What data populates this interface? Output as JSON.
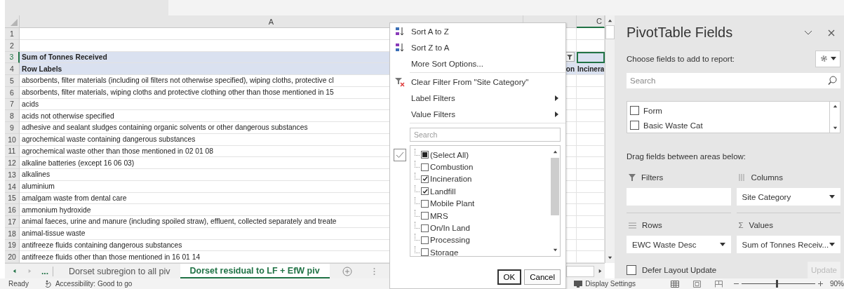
{
  "sheet": {
    "column_a": "A",
    "column_c": "C",
    "rows": [
      {
        "number": "1",
        "kind": "blank",
        "selected": false
      },
      {
        "number": "2",
        "kind": "blank",
        "selected": false
      },
      {
        "number": "3",
        "kind": "header",
        "label": "Sum of Tonnes Received",
        "filter_button": true,
        "selected": true
      },
      {
        "number": "4",
        "kind": "header",
        "label": "Row Labels",
        "column_b": "on",
        "column_c": "Incinera",
        "selected": false
      },
      {
        "number": "5",
        "kind": "item",
        "label": "absorbents, filter materials (including oil filters not otherwise specified), wiping cloths, protective cl",
        "selected": false
      },
      {
        "number": "6",
        "kind": "item",
        "label": "absorbents, filter materials, wiping cloths and protective clothing other than those mentioned in 15",
        "selected": false
      },
      {
        "number": "7",
        "kind": "item",
        "label": "acids",
        "selected": false
      },
      {
        "number": "8",
        "kind": "item",
        "label": "acids not otherwise specified",
        "selected": false
      },
      {
        "number": "9",
        "kind": "item",
        "label": "adhesive and sealant sludges containing organic solvents or other dangerous substances",
        "selected": false
      },
      {
        "number": "10",
        "kind": "item",
        "label": "agrochemical waste containing dangerous substances",
        "selected": false
      },
      {
        "number": "11",
        "kind": "item",
        "label": "agrochemical waste other than those mentioned in 02 01 08",
        "selected": false
      },
      {
        "number": "12",
        "kind": "item",
        "label": "alkaline batteries (except 16 06 03)",
        "selected": false
      },
      {
        "number": "13",
        "kind": "item",
        "label": "alkalines",
        "selected": false
      },
      {
        "number": "14",
        "kind": "item",
        "label": "aluminium",
        "selected": false
      },
      {
        "number": "15",
        "kind": "item",
        "label": "amalgam waste from dental care",
        "selected": false
      },
      {
        "number": "16",
        "kind": "item",
        "label": "ammonium hydroxide",
        "selected": false
      },
      {
        "number": "17",
        "kind": "item",
        "label": "animal faeces, urine and manure (including spoiled straw), effluent, collected separately and treate",
        "selected": false
      },
      {
        "number": "18",
        "kind": "item",
        "label": "animal-tissue waste",
        "selected": false
      },
      {
        "number": "19",
        "kind": "item",
        "label": "antifreeze fluids containing dangerous substances",
        "selected": false
      },
      {
        "number": "20",
        "kind": "item",
        "label": "antifreeze fluids other than those mentioned in 16 01 14",
        "selected": false
      }
    ],
    "tab_overflow": "...",
    "tabs": [
      {
        "label": "Dorset subregion to all piv",
        "selected": false
      },
      {
        "label": "Dorset residual to LF + EfW piv",
        "selected": true
      }
    ]
  },
  "filter_menu": {
    "sort_items": [
      {
        "label": "Sort A to Z",
        "kind": "sort-asc"
      },
      {
        "label": "Sort Z to A",
        "kind": "sort-desc"
      },
      {
        "label": "More Sort Options...",
        "kind": "plain"
      }
    ],
    "filter_items": [
      {
        "label": "Clear Filter From \"Site Category\"",
        "kind": "clear",
        "submenu": false
      },
      {
        "label": "Label Filters",
        "kind": "plain",
        "submenu": true
      },
      {
        "label": "Value Filters",
        "kind": "plain",
        "submenu": true
      }
    ],
    "search": {
      "placeholder": "Search"
    },
    "values": [
      {
        "label": "(Select All)",
        "checked": true,
        "mixed": true
      },
      {
        "label": "Combustion",
        "checked": false
      },
      {
        "label": "Incineration",
        "checked": true
      },
      {
        "label": "Landfill",
        "checked": true
      },
      {
        "label": "Mobile Plant",
        "checked": false
      },
      {
        "label": "MRS",
        "checked": false
      },
      {
        "label": "On/In Land",
        "checked": false
      },
      {
        "label": "Processing",
        "checked": false
      },
      {
        "label": "Storage",
        "checked": false
      }
    ],
    "buttons": [
      "OK",
      "Cancel"
    ]
  },
  "pivot": {
    "title": "PivotTable Fields",
    "choose_label": "Choose fields to add to report:",
    "search": {
      "placeholder": "Search"
    },
    "fields": [
      {
        "label": "Form",
        "checked": false
      },
      {
        "label": "Basic Waste Cat",
        "checked": false
      }
    ],
    "drag_label": "Drag fields between areas below:",
    "areas": [
      {
        "kind": "filters",
        "label": "Filters"
      },
      {
        "kind": "columns",
        "label": "Columns",
        "field": "Site Category"
      },
      {
        "kind": "rows",
        "label": "Rows",
        "field": "EWC Waste Desc"
      },
      {
        "kind": "values",
        "label": "Values",
        "icon": "Σ",
        "field": "Sum of Tonnes Receiv..."
      }
    ],
    "defer": {
      "label": "Defer Layout Update",
      "checked": false
    },
    "update": {
      "label": "Update",
      "disabled": true
    }
  },
  "status": {
    "ready": "Ready",
    "accessibility": "Accessibility: Good to go",
    "display_settings": "Display Settings",
    "zoom": {
      "level": 0.48,
      "reading": "90%"
    }
  }
}
